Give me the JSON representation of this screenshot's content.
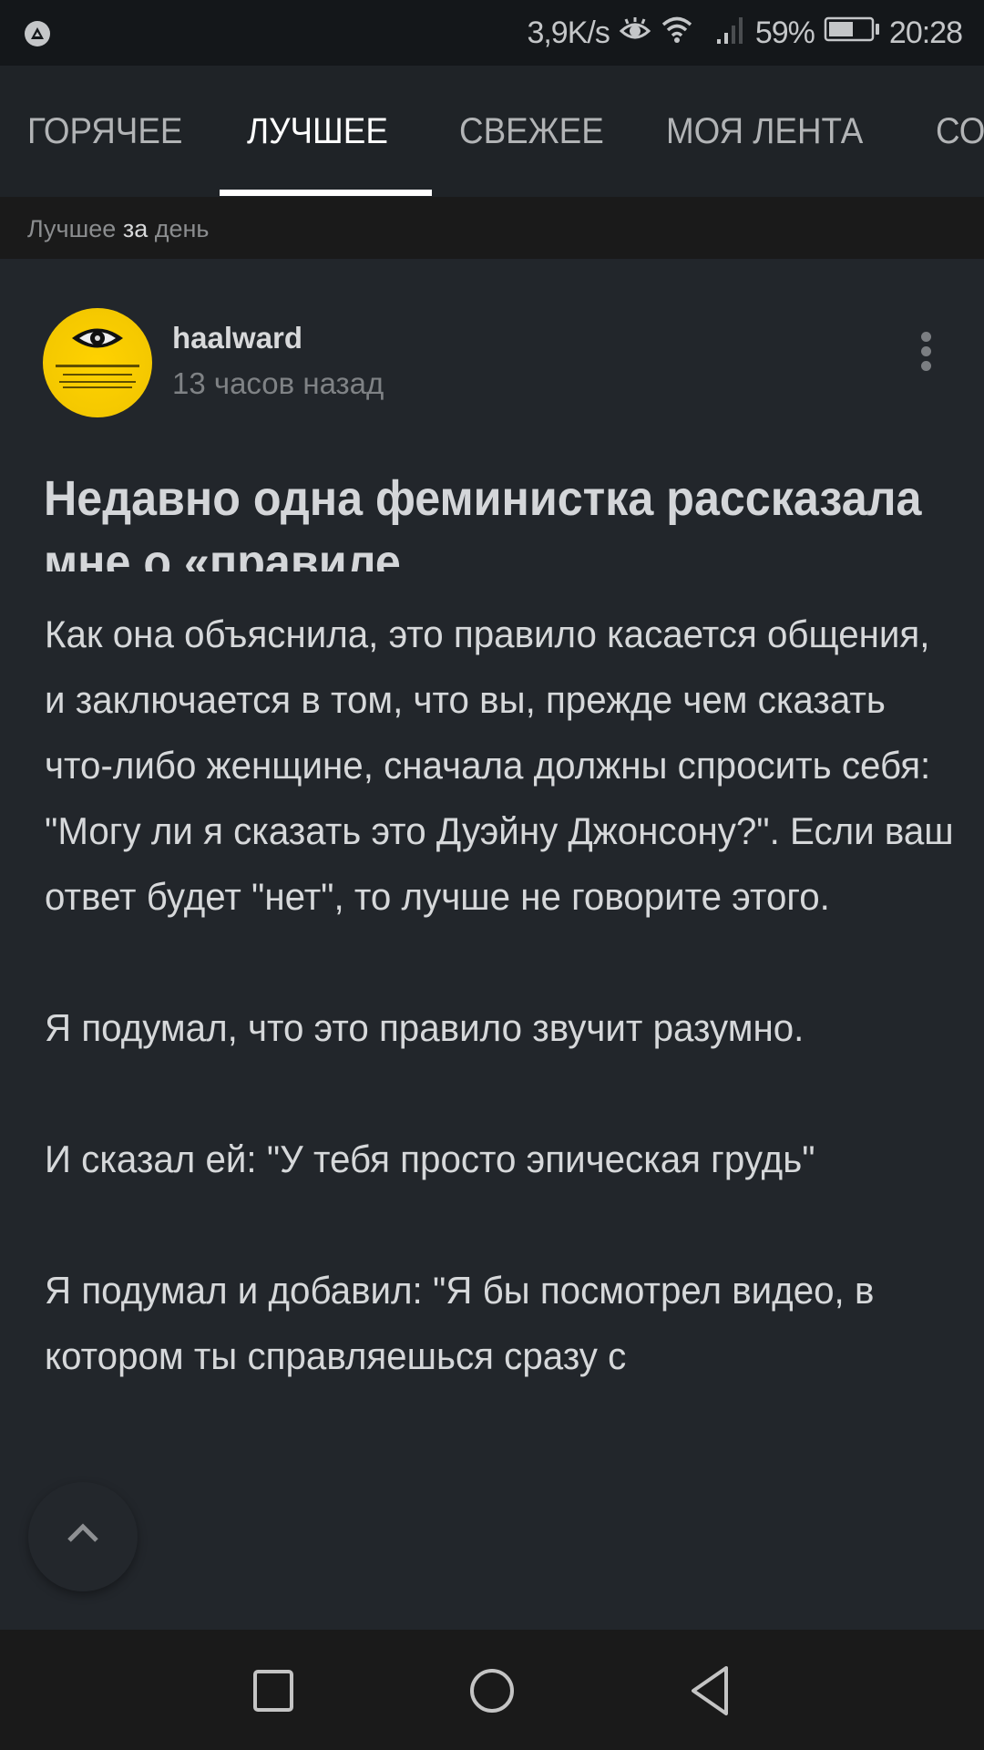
{
  "status_bar": {
    "app_icon": "pikabu-triangle-icon",
    "net_speed": "3,9K/s",
    "icons": [
      "eye-comfort-icon",
      "wifi-icon",
      "signal-icon",
      "battery-icon"
    ],
    "battery_percent": "59%",
    "battery_level": 0.59,
    "time": "20:28"
  },
  "tabs": {
    "items": [
      {
        "label": "ГОРЯЧЕЕ",
        "active": false
      },
      {
        "label": "ЛУЧШЕЕ",
        "active": true
      },
      {
        "label": "СВЕЖЕЕ",
        "active": false
      },
      {
        "label": "МОЯ ЛЕНТА",
        "active": false
      },
      {
        "label": "СООБЩЕСТВА",
        "active": false
      }
    ]
  },
  "subheader": {
    "part1": "Лучшее",
    "part2": "за",
    "part3": "день"
  },
  "post": {
    "author": "haalward",
    "time": "13 часов назад",
    "avatar_icon": "government-eye-avatar",
    "title": "Недавно одна феминистка рассказала мне о «правиле",
    "paragraphs": [
      "Как она объяснила, это правило касается общения, и заключается в том, что вы, прежде чем сказать что-либо женщине, сначала должны спросить себя: \"Могу ли я сказать это Дуэйну Джонсону?\". Если ваш ответ будет \"нет\", то лучше не говорите этого.",
      "Я подумал, что это правило звучит разумно.",
      "И сказал ей: \"У тебя просто эпическая грудь\"",
      "Я подумал и добавил: \"Я бы посмотрел видео, в котором ты справляешься сразу с"
    ]
  },
  "nav": {
    "recent": "recent-apps-square-icon",
    "home": "home-circle-icon",
    "back": "back-triangle-icon"
  },
  "colors": {
    "background": "#22262b",
    "tab_bar": "#1f2327",
    "status_bar": "#14171a",
    "subheader": "#1a1a1a",
    "avatar_yellow": "#ffd200"
  }
}
